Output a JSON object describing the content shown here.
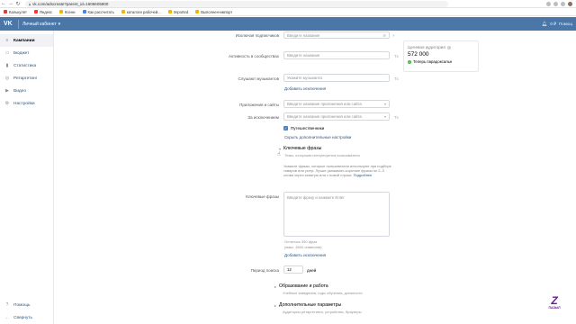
{
  "browser": {
    "url": "vk.com/adscreate?parent_id=1606605800",
    "bookmarks": [
      {
        "label": "Калькулят",
        "color": "#e53935"
      },
      {
        "label": "Яндекс",
        "color": "#ff3333"
      },
      {
        "label": "Ксени",
        "color": "#f4b400"
      },
      {
        "label": "Как рассчитать",
        "color": "#4285f4"
      },
      {
        "label": "каталоги рабочей...",
        "color": "#f4b400"
      },
      {
        "label": "Imported",
        "color": "#f4b400"
      },
      {
        "label": "Выполнен-импорт",
        "color": "#f4b400"
      }
    ]
  },
  "header": {
    "logo": "VK",
    "cabinet": "Личный кабинет",
    "balance": "0 ₽",
    "help": "Помощ"
  },
  "sidebar": {
    "items": [
      {
        "label": "Кампании",
        "icon": "list-icon",
        "active": true
      },
      {
        "label": "Бюджет",
        "icon": "wallet-icon",
        "active": false
      },
      {
        "label": "Статистика",
        "icon": "chart-icon",
        "active": false
      },
      {
        "label": "Ретаргетинг",
        "icon": "target-icon",
        "active": false
      },
      {
        "label": "Видео",
        "icon": "video-icon",
        "active": false
      },
      {
        "label": "Настройки",
        "icon": "gear-icon",
        "active": false
      }
    ],
    "bottom": [
      {
        "label": "Помощь",
        "icon": "help-icon"
      },
      {
        "label": "Свернуть",
        "icon": "collapse-icon"
      }
    ]
  },
  "form": {
    "row1": {
      "label": "Исключая подписчиков",
      "placeholder": "Введите название"
    },
    "row2": {
      "label": "Активность в сообществах",
      "placeholder": "Введите название",
      "suffix": "Тх"
    },
    "row3": {
      "label": "Слушают музыкантов",
      "placeholder": "Укажите музыканта",
      "suffix": "Тх",
      "link": "Добавить исключения"
    },
    "row4": {
      "label": "Приложения и сайты",
      "placeholder": "Введите название приложения или сайта"
    },
    "row5": {
      "label": "За исключением",
      "placeholder": "Введите название приложения или сайта",
      "suffix": "Тх"
    },
    "travelers": {
      "label": "Путешественники"
    },
    "hide_link": "Скрыть дополнительные настройки",
    "keywords_section": {
      "title": "Ключевые фразы",
      "subtitle": "Темы, которыми интересуются пользователи"
    },
    "hint": {
      "text": "Укажите фразы, которые пользователи используют при подборе товаров или услуг. Лучше указывать короткие фразы по 2–3 слова через запятую или с новой строки.",
      "link": "Подробнее"
    },
    "keywords": {
      "label": "Ключевые фразы",
      "placeholder": "Введите фразу и нажмите Enter",
      "remaining": "Осталось 350 фраз",
      "chars": "(макс. 4500 символов)",
      "link": "Добавить исключения"
    },
    "period": {
      "label": "Период поиска",
      "value": "12",
      "unit": "дней"
    },
    "education": {
      "title": "Образование и работа",
      "subtitle": "Учебные заведения, годы обучения, должности"
    },
    "extra": {
      "title": "Дополнительные параметры",
      "subtitle": "Аудитории ретаргетинга, устройства, браузеры"
    }
  },
  "audience": {
    "title": "Целевая аудитория",
    "count": "572 000",
    "status": "Теперь парадоксальн"
  },
  "watermark": {
    "letter": "Z",
    "text": "ПАЗЫЛ"
  }
}
